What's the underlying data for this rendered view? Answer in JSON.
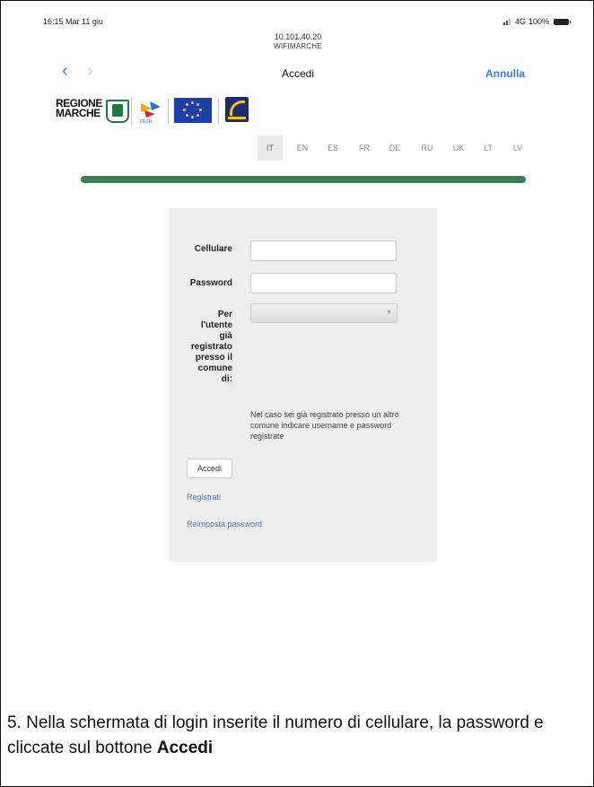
{
  "status_bar": {
    "time": "16:15  Mar 11 giu",
    "network": "4G",
    "battery": "100%"
  },
  "address": {
    "ip": "10.101.40.20",
    "ssid": "WIFIMARCHE"
  },
  "nav": {
    "back": "‹",
    "forward": "›",
    "title": "Accedi",
    "cancel": "Annulla"
  },
  "logos": {
    "regione_line1": "REGIONE",
    "regione_line2": "MARCHE",
    "fesr": "FESR"
  },
  "languages": [
    "IT",
    "EN",
    "ES",
    "FR",
    "DE",
    "RU",
    "UK",
    "LT",
    "LV"
  ],
  "active_language": "IT",
  "form": {
    "phone_label": "Cellulare",
    "phone_value": "",
    "password_label": "Password",
    "password_value": "",
    "municipality_label_lines": [
      "Per",
      "l'utente",
      "già",
      "registrato",
      "presso il",
      "comune",
      "di:"
    ],
    "municipality_value": "",
    "help_text": "Nel caso sei già registrato presso un altro comune indicare username e password registrate",
    "submit_label": "Accedi",
    "register_link": "Registrati",
    "reset_link": "Reimposta password"
  },
  "caption": {
    "text": "5. Nella schermata di login inserite il numero di cellulare, la password e cliccate sul bottone ",
    "bold": "Accedi"
  },
  "colors": {
    "accent": "#3a7bd5",
    "progress_bar": "#3e7b57",
    "link": "#4a7bb5",
    "panel": "#eeeeee"
  }
}
